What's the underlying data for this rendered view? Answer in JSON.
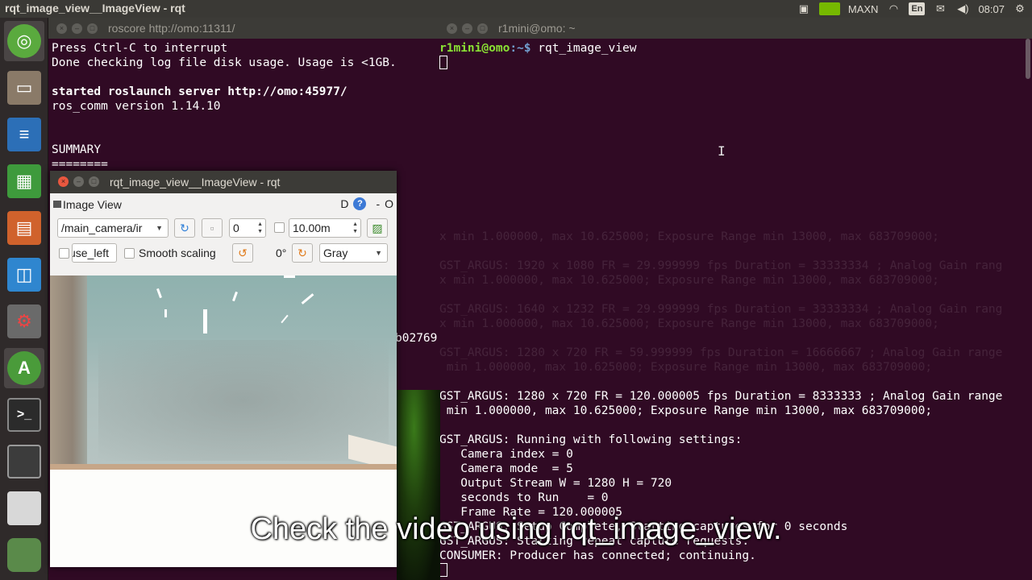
{
  "topbar": {
    "title": "rqt_image_view__ImageView - rqt",
    "nvidia_mode": "MAXN",
    "keyboard_layout": "En",
    "clock": "08:07"
  },
  "launcher": {
    "items": [
      {
        "name": "ubuntu-dash-icon",
        "color": "#5aaa3e"
      },
      {
        "name": "file-manager-icon",
        "color": "#7c6a5a"
      },
      {
        "name": "writer-icon",
        "color": "#2c6fb7"
      },
      {
        "name": "calc-icon",
        "color": "#3e9a3c"
      },
      {
        "name": "impress-icon",
        "color": "#d0622c"
      },
      {
        "name": "software-center-icon",
        "color": "#2f86cf"
      },
      {
        "name": "system-settings-icon",
        "color": "#6a6a6a"
      },
      {
        "name": "software-updater-icon",
        "color": "#4a9b3a"
      },
      {
        "name": "terminal-icon",
        "color": "#2b2b2b"
      },
      {
        "name": "workspace-icon",
        "color": "#3c3c3c"
      },
      {
        "name": "removable-drive-icon",
        "color": "#d8d8d8"
      },
      {
        "name": "trash-icon",
        "color": "#5a8a4a"
      }
    ]
  },
  "left_terminal": {
    "title": "roscore http://omo:11311/",
    "lines": [
      "Press Ctrl-C to interrupt",
      "Done checking log file disk usage. Usage is <1GB.",
      "",
      "started roslaunch server http://omo:45977/",
      "ros_comm version 1.14.10",
      "",
      "",
      "SUMMARY",
      "========"
    ],
    "partial_text": "b02769:"
  },
  "right_terminal": {
    "title": "r1mini@omo: ~",
    "prompt_user": "r1mini@omo",
    "prompt_path": ":~$ ",
    "command": "rqt_image_view",
    "faded_lines": [
      "x min 1.000000, max 10.625000; Exposure Range min 13000, max 683709000;",
      "",
      "GST_ARGUS: 1920 x 1080 FR = 29.999999 fps Duration = 33333334 ; Analog Gain rang",
      "x min 1.000000, max 10.625000; Exposure Range min 13000, max 683709000;",
      "",
      "GST_ARGUS: 1640 x 1232 FR = 29.999999 fps Duration = 33333334 ; Analog Gain rang",
      "x min 1.000000, max 10.625000; Exposure Range min 13000, max 683709000;",
      "",
      "GST_ARGUS: 1280 x 720 FR = 59.999999 fps Duration = 16666667 ; Analog Gain range",
      " min 1.000000, max 10.625000; Exposure Range min 13000, max 683709000;"
    ],
    "lines": [
      "GST_ARGUS: 1280 x 720 FR = 120.000005 fps Duration = 8333333 ; Analog Gain range",
      " min 1.000000, max 10.625000; Exposure Range min 13000, max 683709000;",
      "",
      "GST_ARGUS: Running with following settings:",
      "   Camera index = 0",
      "   Camera mode  = 5",
      "   Output Stream W = 1280 H = 720",
      "   seconds to Run    = 0",
      "   Frame Rate = 120.000005",
      "GST_ARGUS: Setup Complete, Starting captures for 0 seconds",
      "GST_ARGUS: Starting repeat capture requests.",
      "CONSUMER: Producer has connected; continuing."
    ]
  },
  "rqt": {
    "title": "rqt_image_view__ImageView - rqt",
    "panel_label": "Image View",
    "panel_buttons": {
      "dock": "D",
      "help": "?",
      "minimize": "-",
      "close": "O"
    },
    "topic": "/main_camera/ir",
    "spin_value": "0",
    "max_range": "10.00m",
    "use_left_label": "use_left",
    "smooth_scaling_label": "Smooth scaling",
    "rotation": "0°",
    "color_scheme": "Gray"
  },
  "subtitle": "Check the video using rqt_image_view."
}
